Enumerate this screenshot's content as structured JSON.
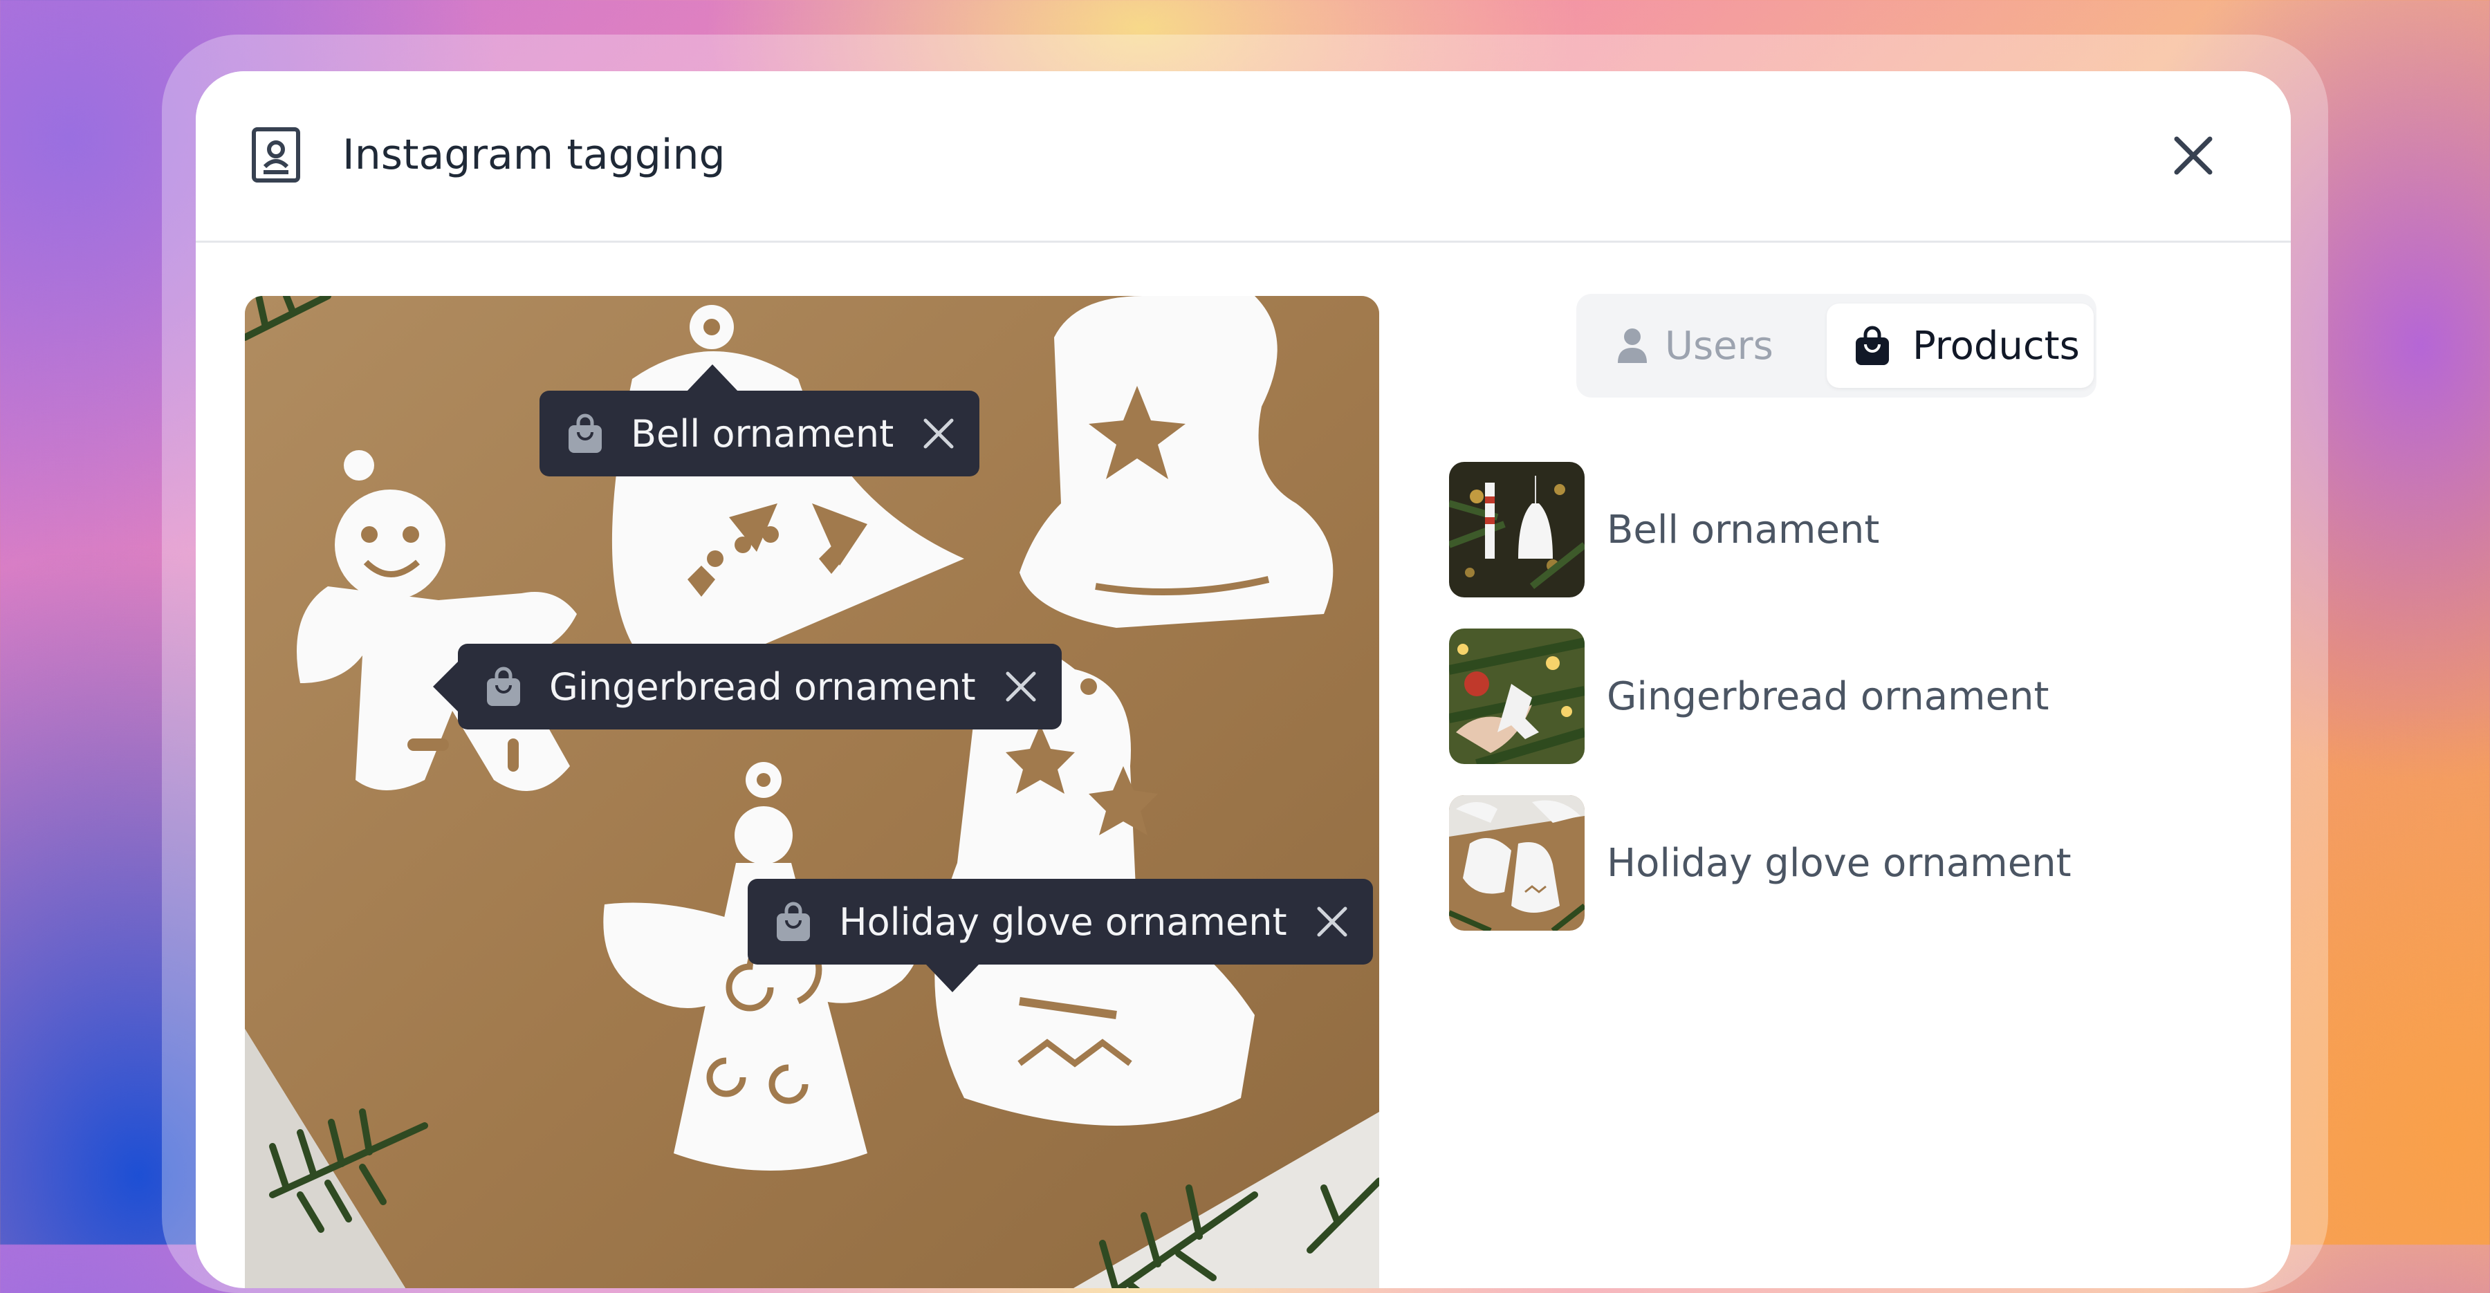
{
  "dialog": {
    "title": "Instagram tagging",
    "header_icon": "contact-card-icon",
    "close_icon": "close-icon"
  },
  "photo": {
    "tags": [
      {
        "label": "Bell ornament",
        "icon": "shopping-bag-icon",
        "remove_icon": "close-icon"
      },
      {
        "label": "Gingerbread ornament",
        "icon": "shopping-bag-icon",
        "remove_icon": "close-icon"
      },
      {
        "label": "Holiday glove ornament",
        "icon": "shopping-bag-icon",
        "remove_icon": "close-icon"
      }
    ]
  },
  "tabs": {
    "users": {
      "label": "Users",
      "icon": "user-icon",
      "active": false
    },
    "products": {
      "label": "Products",
      "icon": "shopping-bag-icon",
      "active": true
    }
  },
  "products": [
    {
      "label": "Bell ornament"
    },
    {
      "label": "Gingerbread ornament"
    },
    {
      "label": "Holiday glove ornament"
    }
  ],
  "colors": {
    "tag_bg": "#2a2d3b",
    "tag_text": "#f3f4f6",
    "title_text": "#1f2937",
    "inactive_tab": "#9ca3af"
  }
}
